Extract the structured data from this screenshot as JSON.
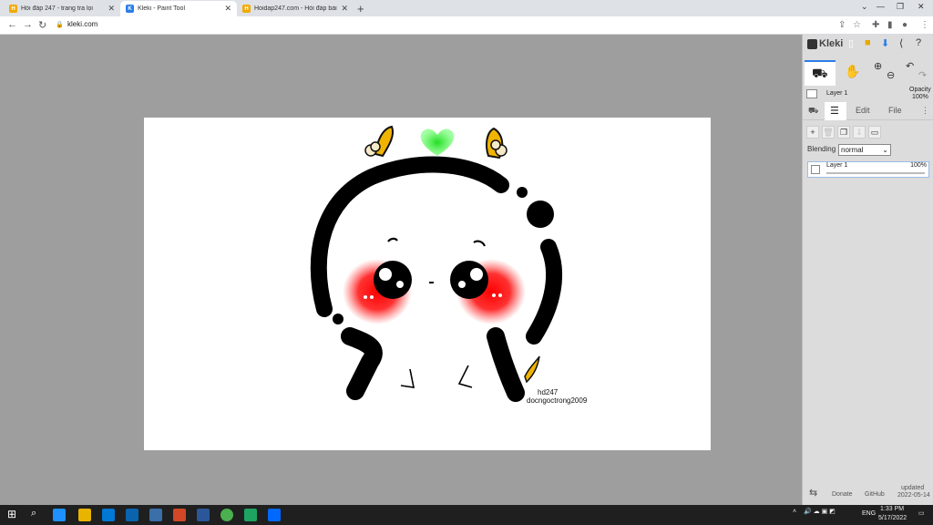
{
  "browser": {
    "tabs": [
      {
        "title": "Hỏi đáp 247 - trang tra lọi",
        "active": false
      },
      {
        "title": "Kleki - Paint Tool",
        "active": true
      },
      {
        "title": "Hoidap247.com - Hỏi đáp bài tập",
        "active": false
      }
    ],
    "url": "kleki.com"
  },
  "app": {
    "name": "Kleki",
    "layer_mini_name": "Layer 1",
    "opacity_label": "Opacity",
    "opacity_value": "100%",
    "panel_tabs": [
      "Edit",
      "File"
    ],
    "blending_label": "Blending",
    "blending_value": "normal",
    "layer_name": "Layer 1",
    "layer_opacity": "100%",
    "footer": {
      "donate": "Donate",
      "github": "GitHub",
      "updated_label": "updated",
      "updated_date": "2022-05-14"
    }
  },
  "canvas": {
    "signature_line1": "hd247",
    "signature_line2": "docngoctrong2009"
  },
  "taskbar": {
    "language": "ENG",
    "time": "1:33 PM",
    "date": "5/17/2022"
  },
  "colors": {
    "accent": "#2b7de9",
    "blush": "#ff0000",
    "heart": "#22dd22",
    "horn": "#f0b400"
  }
}
